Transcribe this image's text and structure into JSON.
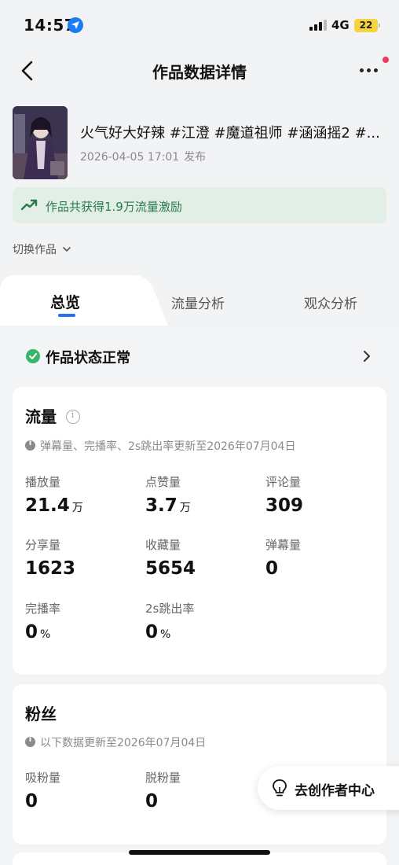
{
  "status_bar": {
    "time": "14:57",
    "network": "4G",
    "battery": "22"
  },
  "nav": {
    "title": "作品数据详情"
  },
  "work": {
    "title": "火气好大好辣 #江澄 #魔道祖师 #涵涵摇2 #...",
    "date": "2026-04-05 17:01",
    "published": "发布"
  },
  "banner": {
    "text": "作品共获得1.9万流量激励"
  },
  "switch_label": "切换作品",
  "tabs": [
    "总览",
    "流量分析",
    "观众分析"
  ],
  "work_status": "作品状态正常",
  "traffic": {
    "title": "流量",
    "note": "弹幕量、完播率、2s跳出率更新至2026年07月04日",
    "metrics": [
      {
        "label": "播放量",
        "value": "21.4",
        "unit": "万"
      },
      {
        "label": "点赞量",
        "value": "3.7",
        "unit": "万"
      },
      {
        "label": "评论量",
        "value": "309",
        "unit": ""
      },
      {
        "label": "分享量",
        "value": "1623",
        "unit": ""
      },
      {
        "label": "收藏量",
        "value": "5654",
        "unit": ""
      },
      {
        "label": "弹幕量",
        "value": "0",
        "unit": ""
      },
      {
        "label": "完播率",
        "value": "0",
        "unit": "%"
      },
      {
        "label": "2s跳出率",
        "value": "0",
        "unit": "%"
      }
    ]
  },
  "fans": {
    "title": "粉丝",
    "note": "以下数据更新至2026年07月04日",
    "metrics": [
      {
        "label": "吸粉量",
        "value": "0"
      },
      {
        "label": "脱粉量",
        "value": "0"
      }
    ]
  },
  "float_button": {
    "label": "去创作者中心"
  },
  "colors": {
    "accent": "#2a6cf6",
    "ok": "#38b56a",
    "banner_bg": "#e2efe7",
    "banner_text": "#2a7a4c"
  }
}
